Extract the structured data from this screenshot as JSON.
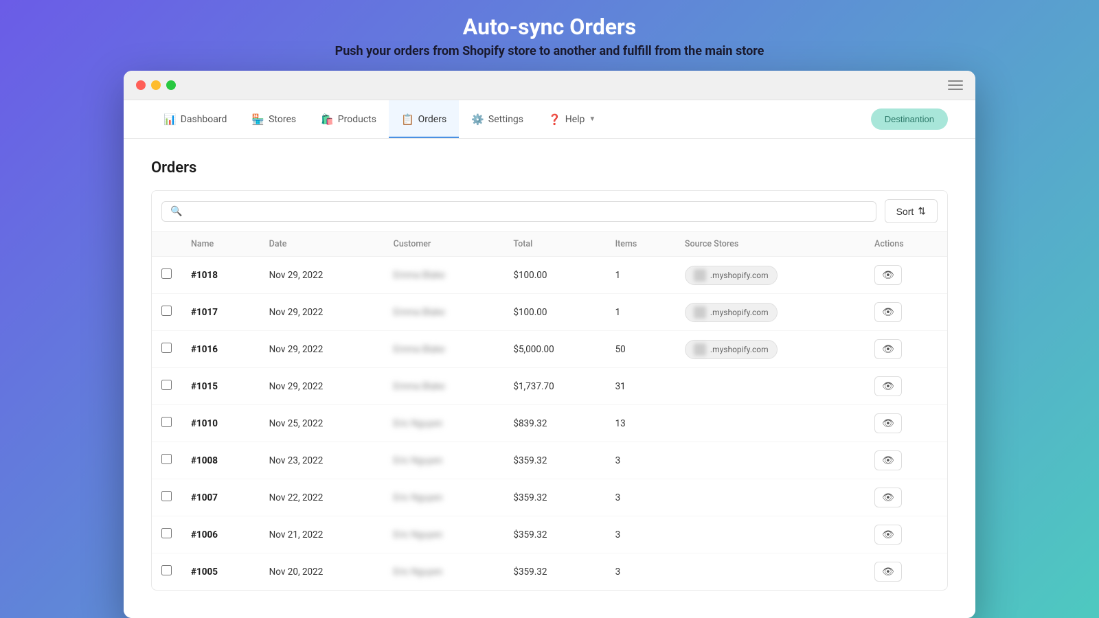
{
  "page": {
    "title": "Auto-sync Orders",
    "subtitle": "Push your orders from Shopify store to another and fulfill from the main store"
  },
  "nav": {
    "items": [
      {
        "id": "dashboard",
        "label": "Dashboard",
        "icon": "📊",
        "active": false
      },
      {
        "id": "stores",
        "label": "Stores",
        "icon": "🏪",
        "active": false
      },
      {
        "id": "products",
        "label": "Products",
        "icon": "🛍️",
        "active": false
      },
      {
        "id": "orders",
        "label": "Orders",
        "icon": "📋",
        "active": true
      },
      {
        "id": "settings",
        "label": "Settings",
        "icon": "⚙️",
        "active": false
      },
      {
        "id": "help",
        "label": "Help",
        "icon": "❓",
        "active": false,
        "dropdown": true
      }
    ],
    "destination_label": "Destinantion"
  },
  "orders": {
    "page_title": "Orders",
    "search_placeholder": "",
    "sort_label": "Sort",
    "columns": [
      "Name",
      "Date",
      "Customer",
      "Total",
      "Items",
      "Source Stores",
      "Actions"
    ],
    "rows": [
      {
        "id": "1018",
        "name": "#1018",
        "date": "Nov 29, 2022",
        "customer": "Emma Blake",
        "total": "$100.00",
        "items": "1",
        "source_store": ".myshopify.com",
        "has_badge": true
      },
      {
        "id": "1017",
        "name": "#1017",
        "date": "Nov 29, 2022",
        "customer": "Emma Blake",
        "total": "$100.00",
        "items": "1",
        "source_store": ".myshopify.com",
        "has_badge": true
      },
      {
        "id": "1016",
        "name": "#1016",
        "date": "Nov 29, 2022",
        "customer": "Emma Blake",
        "total": "$5,000.00",
        "items": "50",
        "source_store": ".myshopify.com",
        "has_badge": true
      },
      {
        "id": "1015",
        "name": "#1015",
        "date": "Nov 29, 2022",
        "customer": "Emma Blake",
        "total": "$1,737.70",
        "items": "31",
        "source_store": "",
        "has_badge": false
      },
      {
        "id": "1010",
        "name": "#1010",
        "date": "Nov 25, 2022",
        "customer": "Eric Nguyen",
        "total": "$839.32",
        "items": "13",
        "source_store": "",
        "has_badge": false
      },
      {
        "id": "1008",
        "name": "#1008",
        "date": "Nov 23, 2022",
        "customer": "Eric Nguyen",
        "total": "$359.32",
        "items": "3",
        "source_store": "",
        "has_badge": false
      },
      {
        "id": "1007",
        "name": "#1007",
        "date": "Nov 22, 2022",
        "customer": "Eric Nguyen",
        "total": "$359.32",
        "items": "3",
        "source_store": "",
        "has_badge": false
      },
      {
        "id": "1006",
        "name": "#1006",
        "date": "Nov 21, 2022",
        "customer": "Eric Nguyen",
        "total": "$359.32",
        "items": "3",
        "source_store": "",
        "has_badge": false
      },
      {
        "id": "1005",
        "name": "#1005",
        "date": "Nov 20, 2022",
        "customer": "Eric Nguyen",
        "total": "$359.32",
        "items": "3",
        "source_store": "",
        "has_badge": false
      }
    ]
  }
}
